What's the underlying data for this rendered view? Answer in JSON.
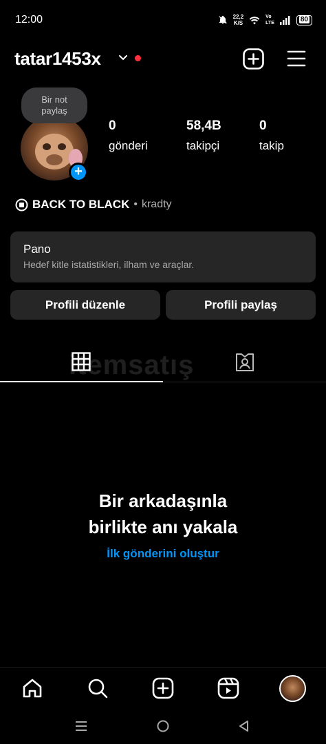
{
  "status_bar": {
    "time": "12:00",
    "speed_value": "22,2",
    "speed_unit": "K/S",
    "volte_top": "Vo",
    "volte_bottom": "LTE",
    "battery": "80"
  },
  "header": {
    "username": "tatar1453x",
    "icons": [
      "chevron-down-icon",
      "new-post-icon",
      "menu-icon"
    ],
    "notification_dot_color": "#ff3040"
  },
  "profile": {
    "note_line1": "Bir not",
    "note_line2": "paylaş",
    "stats": [
      {
        "value": "0",
        "label": "gönderi"
      },
      {
        "value": "58,4B",
        "label": "takipçi"
      },
      {
        "value": "0",
        "label": "takip"
      }
    ],
    "music": {
      "title": "BACK TO BLACK",
      "separator": "•",
      "artist": "kradty"
    }
  },
  "pano": {
    "title": "Pano",
    "subtitle": "Hedef kitle istatistikleri, ilham ve araçlar."
  },
  "buttons": {
    "edit_profile": "Profili düzenle",
    "share_profile": "Profili paylaş"
  },
  "tabs": [
    "grid-icon",
    "tagged-icon"
  ],
  "watermark": "itemsatış",
  "empty_state": {
    "title_line1": "Bir arkadaşınla",
    "title_line2": "birlikte anı yakala",
    "link": "İlk gönderini oluştur"
  },
  "bottom_nav": [
    "home-icon",
    "search-icon",
    "create-icon",
    "reels-icon",
    "profile-avatar"
  ],
  "colors": {
    "accent": "#0095f6",
    "card": "#262626",
    "background": "#000000"
  }
}
